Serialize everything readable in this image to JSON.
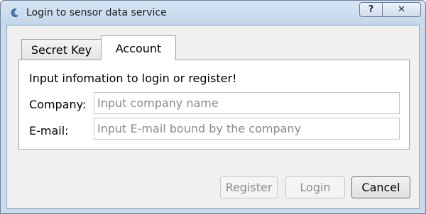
{
  "window": {
    "title": "Login to sensor data service",
    "help_label": "?",
    "close_label": "✕"
  },
  "tabs": [
    {
      "label": "Secret Key",
      "selected": false
    },
    {
      "label": "Account",
      "selected": true
    }
  ],
  "account": {
    "prompt": "Input infomation to login or register!",
    "company_label": "Company:",
    "company_placeholder": "Input company name",
    "company_value": "",
    "email_label": "E-mail:",
    "email_placeholder": "Input E-mail bound by the company",
    "email_value": ""
  },
  "buttons": {
    "register": "Register",
    "login": "Login",
    "cancel": "Cancel"
  }
}
